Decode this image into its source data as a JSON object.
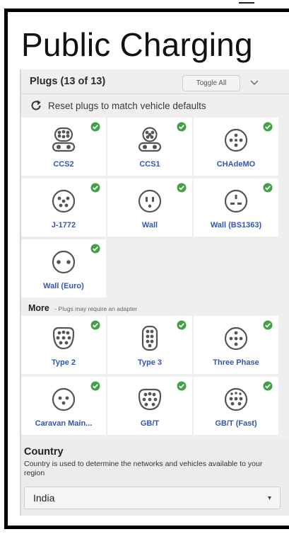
{
  "page": {
    "title": "Public Charging"
  },
  "plugs": {
    "header": "Plugs (13 of 13)",
    "toggle_all_label": "Toggle All",
    "reset_label": "Reset plugs to match vehicle defaults",
    "items": [
      {
        "label": "CCS2",
        "icon": "ccs2-icon",
        "selected": true
      },
      {
        "label": "CCS1",
        "icon": "ccs1-icon",
        "selected": true
      },
      {
        "label": "CHAdeMO",
        "icon": "chademo-icon",
        "selected": true
      },
      {
        "label": "J-1772",
        "icon": "j1772-icon",
        "selected": true
      },
      {
        "label": "Wall",
        "icon": "wall-outlet-icon",
        "selected": true
      },
      {
        "label": "Wall (BS1363)",
        "icon": "bs1363-icon",
        "selected": true
      },
      {
        "label": "Wall (Euro)",
        "icon": "euro-outlet-icon",
        "selected": true
      }
    ]
  },
  "more": {
    "label": "More",
    "note": "- Plugs may require an adapter",
    "items": [
      {
        "label": "Type 2",
        "icon": "type2-icon",
        "selected": true
      },
      {
        "label": "Type 3",
        "icon": "type3-icon",
        "selected": true
      },
      {
        "label": "Three Phase",
        "icon": "three-phase-icon",
        "selected": true
      },
      {
        "label": "Caravan Main...",
        "icon": "caravan-mains-icon",
        "selected": true
      },
      {
        "label": "GB/T",
        "icon": "gbt-icon",
        "selected": true
      },
      {
        "label": "GB/T (Fast)",
        "icon": "gbt-fast-icon",
        "selected": true
      }
    ]
  },
  "country": {
    "title": "Country",
    "description": "Country is used to determine the networks and vehicles available to your region",
    "selected": "India"
  },
  "colors": {
    "accent_blue": "#3456b0",
    "check_green": "#43a047"
  }
}
